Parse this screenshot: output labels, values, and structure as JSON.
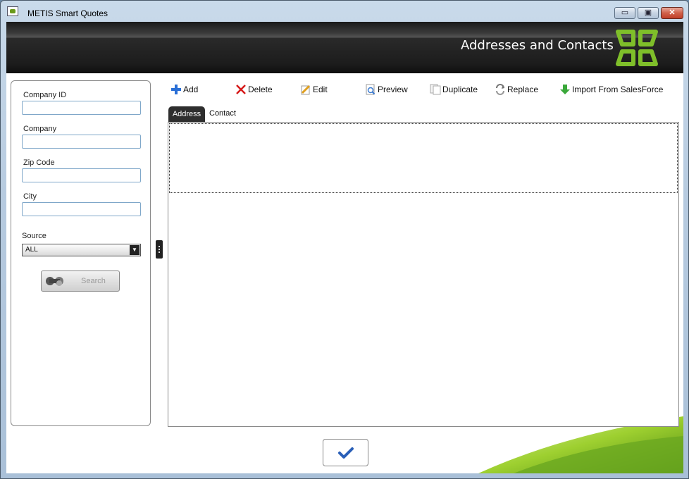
{
  "window": {
    "title": "METIS Smart Quotes",
    "controls": {
      "minimize": "▭",
      "maximize": "▣",
      "close": "✕"
    }
  },
  "banner": {
    "title": "Addresses and Contacts"
  },
  "filters": {
    "company_id_label": "Company ID",
    "company_id_value": "",
    "company_label": "Company",
    "company_value": "",
    "zip_label": "Zip Code",
    "zip_value": "",
    "city_label": "City",
    "city_value": "",
    "source_label": "Source",
    "source_value": "ALL",
    "search_label": "Search"
  },
  "toolbar": {
    "add": "Add",
    "delete": "Delete",
    "edit": "Edit",
    "preview": "Preview",
    "duplicate": "Duplicate",
    "replace": "Replace",
    "import": "Import From SalesForce"
  },
  "tabs": [
    "Address",
    "Contact"
  ],
  "colors": {
    "banner": "#1c1c1c",
    "accent_green": "#7fbf2a",
    "tab_active": "#2e2e2e",
    "input_border": "#7fa7c9"
  },
  "icons": [
    "app-icon",
    "add-icon",
    "delete-icon",
    "edit-icon",
    "preview-icon",
    "duplicate-icon",
    "replace-icon",
    "import-icon",
    "binoculars-icon",
    "checkmark-icon",
    "metis-logo"
  ]
}
